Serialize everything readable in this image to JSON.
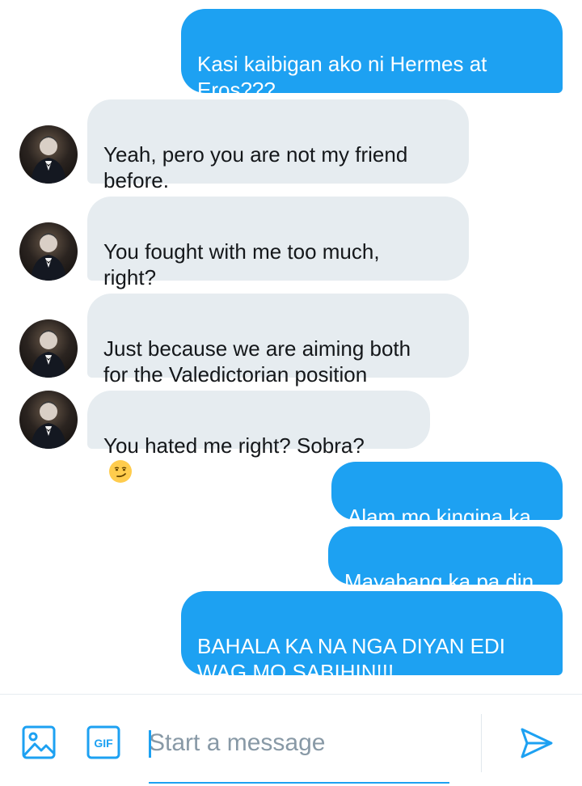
{
  "messages": [
    {
      "direction": "sent",
      "text": "Kasi kaibigan ako ni Hermes at\nEros???"
    },
    {
      "direction": "received",
      "text": "Yeah, pero you are not my friend\nbefore."
    },
    {
      "direction": "received",
      "text": "You fought with me too much,\nright?"
    },
    {
      "direction": "received",
      "text": "Just because we are aiming both\nfor the Valedictorian position"
    },
    {
      "direction": "received",
      "text": "You hated me right? Sobra?",
      "emoji": "smirking-face"
    },
    {
      "direction": "sent",
      "text": "Alam mo kingina ka"
    },
    {
      "direction": "sent",
      "text": "Mayabang ka pa din"
    },
    {
      "direction": "sent",
      "text": "BAHALA KA NA NGA DIYAN EDI\nWAG MO SABIHIN!!!"
    }
  ],
  "composer": {
    "placeholder": "Start a message",
    "value": "",
    "media_icon": "image-icon",
    "gif_label": "GIF",
    "send_icon": "send-icon"
  },
  "colors": {
    "accent": "#1da1f2",
    "received_bubble": "#e6ecf0",
    "text": "#14171a",
    "placeholder": "#8899a6"
  }
}
